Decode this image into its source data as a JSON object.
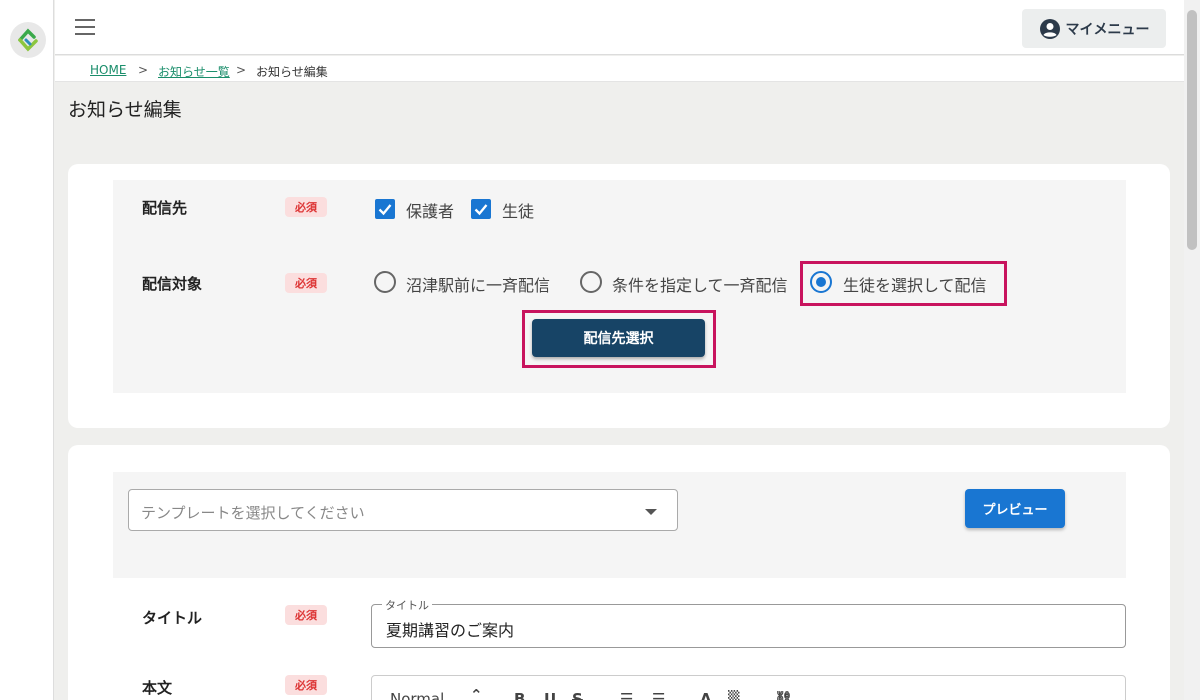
{
  "header": {
    "my_menu_label": "マイメニュー"
  },
  "breadcrumb": {
    "home": "HOME",
    "sep": ">",
    "list": "お知らせ一覧",
    "current": "お知らせ編集"
  },
  "page": {
    "title": "お知らせ編集"
  },
  "delivery": {
    "recipients_label": "配信先",
    "required_badge": "必須",
    "recipient_options": [
      "保護者",
      "生徒"
    ],
    "target_label": "配信対象",
    "target_options": [
      "沼津駅前に一斉配信",
      "条件を指定して一斉配信",
      "生徒を選択して配信"
    ],
    "select_button": "配信先選択"
  },
  "template": {
    "placeholder": "テンプレートを選択してください",
    "preview_button": "プレビュー"
  },
  "title_field": {
    "label": "タイトル",
    "legend": "タイトル",
    "value": "夏期講習のご案内"
  },
  "body_field": {
    "label": "本文",
    "format_option": "Normal"
  },
  "colors": {
    "accent": "#1976d2",
    "dark_button": "#174466",
    "highlight": "#c8145e",
    "required_bg": "#fbdede"
  }
}
